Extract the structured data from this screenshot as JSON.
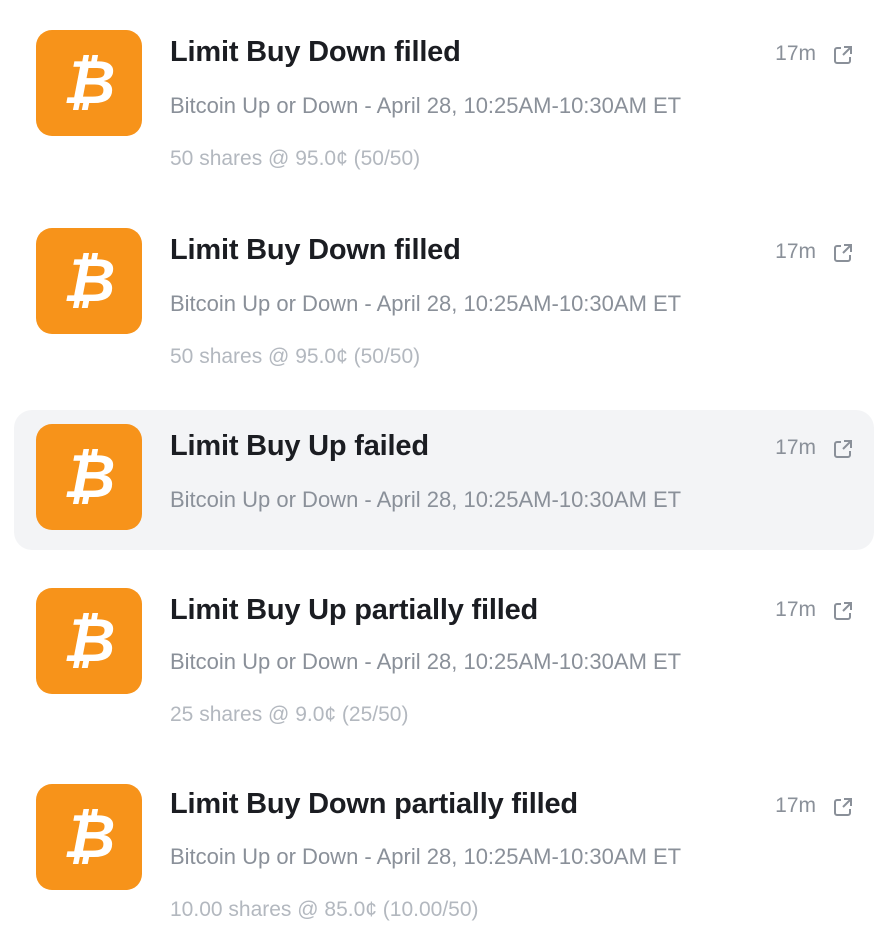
{
  "accent_color": "#f7931a",
  "notifications": [
    {
      "icon": "bitcoin-icon",
      "title": "Limit Buy Down filled",
      "market": "Bitcoin Up or Down - April 28, 10:25AM-10:30AM ET",
      "detail": "50 shares @ 95.0¢ (50/50)",
      "time": "17m"
    },
    {
      "icon": "bitcoin-icon",
      "title": "Limit Buy Down filled",
      "market": "Bitcoin Up or Down - April 28, 10:25AM-10:30AM ET",
      "detail": "50 shares @ 95.0¢ (50/50)",
      "time": "17m"
    },
    {
      "icon": "bitcoin-icon",
      "title": "Limit Buy Up failed",
      "market": "Bitcoin Up or Down - April 28, 10:25AM-10:30AM ET",
      "detail": "",
      "time": "17m",
      "highlighted": true
    },
    {
      "icon": "bitcoin-icon",
      "title": "Limit Buy Up partially filled",
      "market": "Bitcoin Up or Down - April 28, 10:25AM-10:30AM ET",
      "detail": "25 shares @ 9.0¢ (25/50)",
      "time": "17m"
    },
    {
      "icon": "bitcoin-icon",
      "title": "Limit Buy Down partially filled",
      "market": "Bitcoin Up or Down - April 28, 10:25AM-10:30AM ET",
      "detail": "10.00 shares @ 85.0¢ (10.00/50)",
      "time": "17m"
    }
  ]
}
